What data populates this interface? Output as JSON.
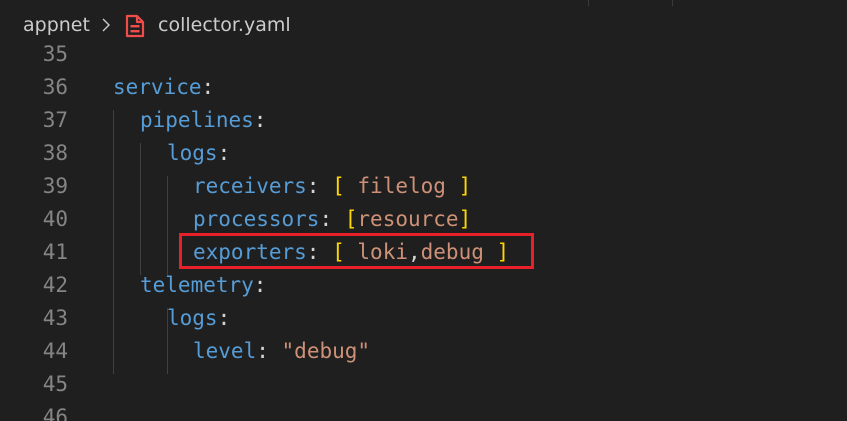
{
  "breadcrumb": {
    "folder": "appnet",
    "file": "collector.yaml",
    "file_icon": "yaml-file-icon",
    "separator_icon": "chevron-right-icon"
  },
  "editor": {
    "lines": [
      {
        "number": "35"
      },
      {
        "number": "36",
        "key": "service",
        "colon": ":"
      },
      {
        "number": "37",
        "key": "pipelines",
        "colon": ":"
      },
      {
        "number": "38",
        "key": "logs",
        "colon": ":"
      },
      {
        "number": "39",
        "key": "receivers",
        "colon": ":",
        "open": "[",
        "value": " filelog ",
        "close": "]"
      },
      {
        "number": "40",
        "key": "processors",
        "colon": ":",
        "open": "[",
        "value": "resource",
        "close": "]"
      },
      {
        "number": "41",
        "key": "exporters",
        "colon": ":",
        "open": "[",
        "value_a": " loki",
        "comma": ",",
        "value_b": "debug ",
        "close": "]"
      },
      {
        "number": "42",
        "key": "telemetry",
        "colon": ":"
      },
      {
        "number": "43",
        "key": "logs",
        "colon": ":"
      },
      {
        "number": "44",
        "key": "level",
        "colon": ":",
        "value": "\"debug\""
      },
      {
        "number": "45"
      },
      {
        "number": "46"
      }
    ]
  },
  "colors": {
    "background": "#1f1f1f",
    "key": "#569cd6",
    "string": "#ce9178",
    "bracket": "#ffd700",
    "highlight": "#e8202a"
  }
}
